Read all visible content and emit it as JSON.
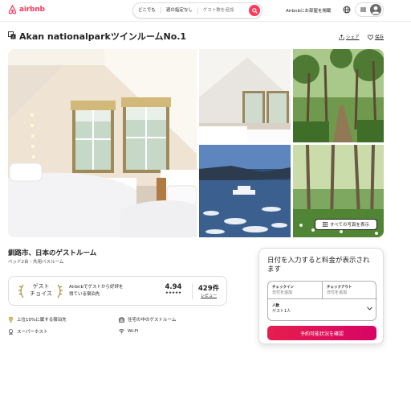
{
  "header": {
    "logo_text": "airbnb",
    "search": {
      "where": "どこでも",
      "when": "週の指定なし",
      "guests": "ゲスト数を追加"
    },
    "host_link": "Airbnbにお部屋を掲載"
  },
  "listing": {
    "title": "Akan nationalparkツインルームNo.1",
    "share_label": "シェア",
    "save_label": "保存",
    "show_all_photos": "すべての写真を表示",
    "location_title": "釧路市、日本のゲストルーム",
    "beds": "ベッド2台・共用バスルーム"
  },
  "guest_favorite": {
    "badge_line1": "ゲスト",
    "badge_line2": "チョイス",
    "text_line1": "Airbnbでゲストから好評を",
    "text_line2": "得ている宿泊先",
    "rating": "4.94",
    "stars": "★★★★★",
    "reviews_count": "429件",
    "reviews_label": "レビュー"
  },
  "features": [
    {
      "icon": "trophy-icon",
      "label": "上位10%に属する宿泊先"
    },
    {
      "icon": "room-icon",
      "label": "住宅の中のゲストルーム"
    },
    {
      "icon": "medal-icon",
      "label": "スーパーホスト"
    },
    {
      "icon": "wifi-icon",
      "label": "Wi-Fi"
    }
  ],
  "booking": {
    "title": "日付を入力すると料金が表示されます",
    "checkin_label": "チェックイン",
    "checkin_placeholder": "日付を追加",
    "checkout_label": "チェックアウト",
    "checkout_placeholder": "日付を追加",
    "guests_label": "人数",
    "guests_value": "ゲスト1人",
    "reserve_button": "予約可能状況を確認"
  },
  "colors": {
    "brand": "#ff385c",
    "reserve_start": "#e61e4d",
    "reserve_end": "#d70466"
  }
}
